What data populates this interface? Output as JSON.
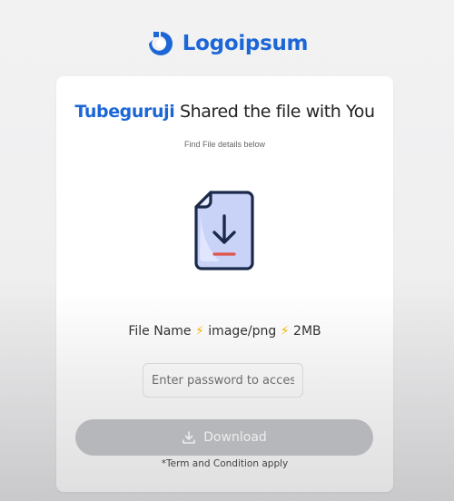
{
  "brand": {
    "name": "Logoipsum",
    "color": "#1c66d6",
    "icon": "logo-mark-icon"
  },
  "share": {
    "user": "Tubeguruji",
    "message": " Shared the file with You",
    "subtitle": "Find File details below"
  },
  "file": {
    "icon": "file-download-icon",
    "name_label": "File Name",
    "type": "image/png",
    "size": "2MB",
    "separator_icon": "lightning-bolt-icon",
    "separator_glyph": "⚡"
  },
  "password": {
    "placeholder": "Enter password to acces",
    "value": ""
  },
  "download": {
    "label": "Download",
    "icon": "download-icon",
    "enabled": false
  },
  "terms": "*Term and Condition apply"
}
